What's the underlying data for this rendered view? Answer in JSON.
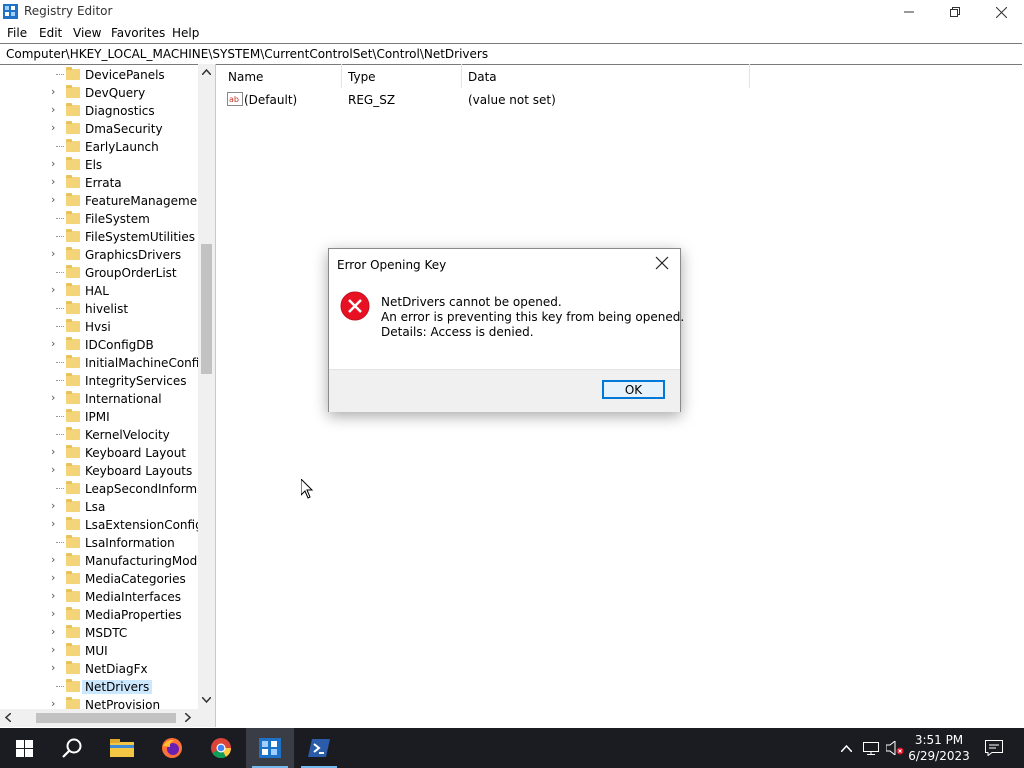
{
  "window": {
    "title": "Registry Editor"
  },
  "menu": [
    "File",
    "Edit",
    "View",
    "Favorites",
    "Help"
  ],
  "address": "Computer\\HKEY_LOCAL_MACHINE\\SYSTEM\\CurrentControlSet\\Control\\NetDrivers",
  "tree": [
    {
      "label": "DevicePanels",
      "expandable": false
    },
    {
      "label": "DevQuery",
      "expandable": true
    },
    {
      "label": "Diagnostics",
      "expandable": true
    },
    {
      "label": "DmaSecurity",
      "expandable": true
    },
    {
      "label": "EarlyLaunch",
      "expandable": false
    },
    {
      "label": "Els",
      "expandable": true
    },
    {
      "label": "Errata",
      "expandable": true
    },
    {
      "label": "FeatureManagement",
      "expandable": true
    },
    {
      "label": "FileSystem",
      "expandable": false
    },
    {
      "label": "FileSystemUtilities",
      "expandable": false
    },
    {
      "label": "GraphicsDrivers",
      "expandable": true
    },
    {
      "label": "GroupOrderList",
      "expandable": false
    },
    {
      "label": "HAL",
      "expandable": true
    },
    {
      "label": "hivelist",
      "expandable": false
    },
    {
      "label": "Hvsi",
      "expandable": false
    },
    {
      "label": "IDConfigDB",
      "expandable": true
    },
    {
      "label": "InitialMachineConfig",
      "expandable": false
    },
    {
      "label": "IntegrityServices",
      "expandable": false
    },
    {
      "label": "International",
      "expandable": true
    },
    {
      "label": "IPMI",
      "expandable": false
    },
    {
      "label": "KernelVelocity",
      "expandable": false
    },
    {
      "label": "Keyboard Layout",
      "expandable": true
    },
    {
      "label": "Keyboard Layouts",
      "expandable": true
    },
    {
      "label": "LeapSecondInformati",
      "expandable": false
    },
    {
      "label": "Lsa",
      "expandable": true
    },
    {
      "label": "LsaExtensionConfig",
      "expandable": true
    },
    {
      "label": "LsaInformation",
      "expandable": false
    },
    {
      "label": "ManufacturingMode",
      "expandable": true
    },
    {
      "label": "MediaCategories",
      "expandable": true
    },
    {
      "label": "MediaInterfaces",
      "expandable": true
    },
    {
      "label": "MediaProperties",
      "expandable": true
    },
    {
      "label": "MSDTC",
      "expandable": true
    },
    {
      "label": "MUI",
      "expandable": true
    },
    {
      "label": "NetDiagFx",
      "expandable": true
    },
    {
      "label": "NetDrivers",
      "expandable": false,
      "selected": true
    },
    {
      "label": "NetProvision",
      "expandable": true
    }
  ],
  "columns": [
    "Name",
    "Type",
    "Data"
  ],
  "values": [
    {
      "name": "(Default)",
      "type": "REG_SZ",
      "data": "(value not set)"
    }
  ],
  "dialog": {
    "title": "Error Opening Key",
    "line1": "NetDrivers cannot be opened.",
    "line2": "An error is preventing this key from being opened.",
    "line3": "Details: Access is denied.",
    "ok": "OK"
  },
  "taskbar": {
    "apps": [
      "start-icon",
      "search-icon",
      "file-explorer-icon",
      "firefox-icon",
      "chrome-icon",
      "registry-editor-icon",
      "powershell-icon"
    ],
    "time": "3:51 PM",
    "date": "6/29/2023"
  },
  "colors": {
    "accent": "#0078d7",
    "error": "#e81123",
    "folder": "#f3d479",
    "taskbar": "#1a1c22"
  }
}
